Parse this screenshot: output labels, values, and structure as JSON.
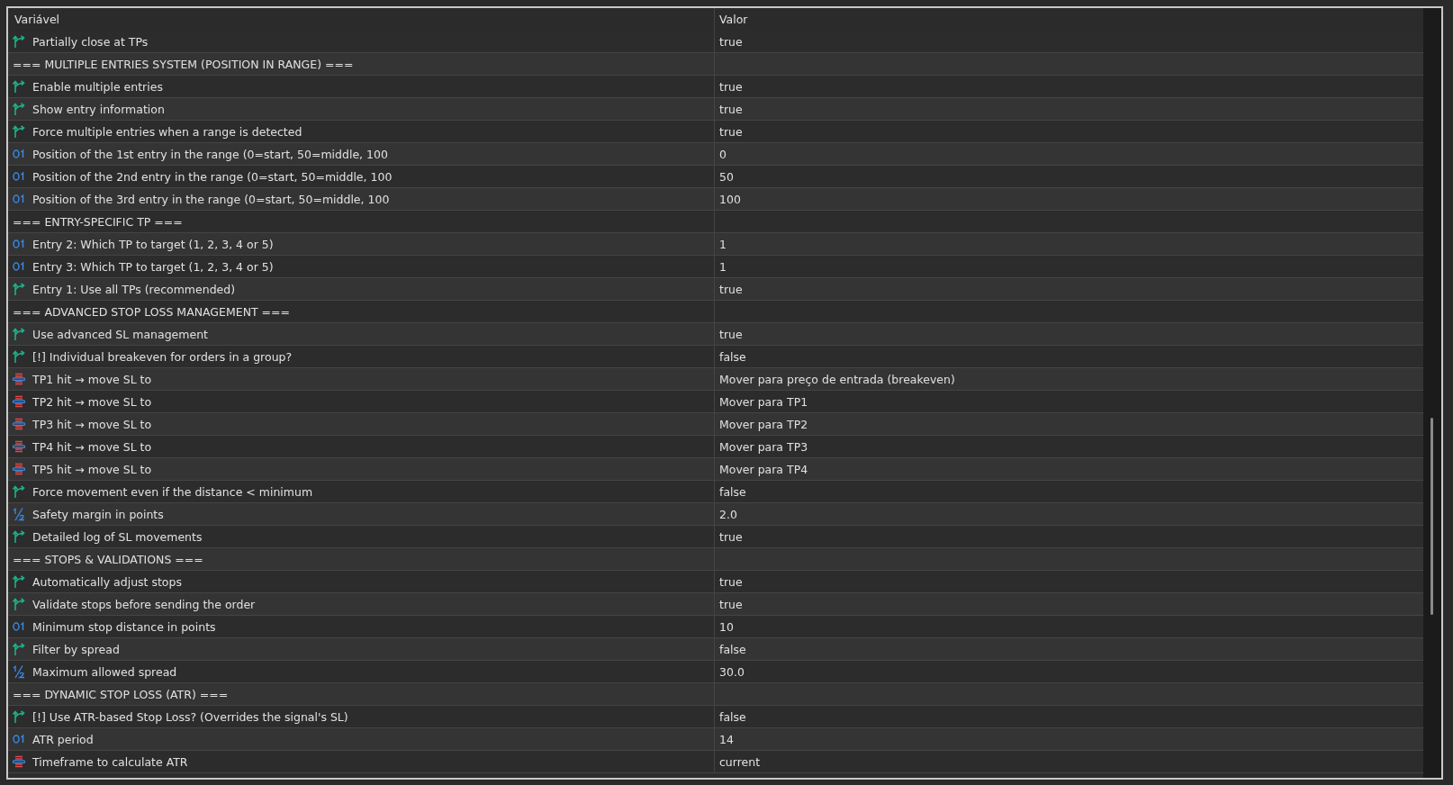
{
  "table": {
    "columns": [
      "Variável",
      "Valor"
    ],
    "rows": [
      {
        "kind": "bool",
        "name": "Partially close at TPs",
        "value": "true"
      },
      {
        "kind": "section",
        "name": "=== MULTIPLE ENTRIES SYSTEM (POSITION IN RANGE) ==="
      },
      {
        "kind": "bool",
        "name": "Enable multiple entries",
        "value": "true"
      },
      {
        "kind": "bool",
        "name": "Show entry information",
        "value": "true"
      },
      {
        "kind": "bool",
        "name": "Force multiple entries when a range is detected",
        "value": "true"
      },
      {
        "kind": "int",
        "name": "Position of the 1st entry in the range (0=start, 50=middle, 100",
        "value": "0"
      },
      {
        "kind": "int",
        "name": "Position of the 2nd entry in the range (0=start, 50=middle, 100",
        "value": "50"
      },
      {
        "kind": "int",
        "name": "Position of the 3rd entry in the range (0=start, 50=middle, 100",
        "value": "100"
      },
      {
        "kind": "section",
        "name": "=== ENTRY-SPECIFIC TP ==="
      },
      {
        "kind": "int",
        "name": "Entry 2: Which TP to target (1, 2, 3, 4 or 5)",
        "value": "1"
      },
      {
        "kind": "int",
        "name": "Entry 3: Which TP to target (1, 2, 3, 4 or 5)",
        "value": "1"
      },
      {
        "kind": "bool",
        "name": "Entry 1: Use all TPs (recommended)",
        "value": "true"
      },
      {
        "kind": "section",
        "name": "=== ADVANCED STOP LOSS MANAGEMENT ==="
      },
      {
        "kind": "bool",
        "name": "Use advanced SL management",
        "value": "true"
      },
      {
        "kind": "bool",
        "name": "[!] Individual breakeven for orders in a group?",
        "value": "false"
      },
      {
        "kind": "enum",
        "name": "TP1 hit → move SL to",
        "value": "Mover para preço de entrada (breakeven)"
      },
      {
        "kind": "enum",
        "name": "TP2 hit → move SL to",
        "value": "Mover para TP1"
      },
      {
        "kind": "enum",
        "name": "TP3 hit → move SL to",
        "value": "Mover para TP2"
      },
      {
        "kind": "enum",
        "name": "TP4 hit → move SL to",
        "value": "Mover para TP3"
      },
      {
        "kind": "enum",
        "name": "TP5 hit → move SL to",
        "value": "Mover para TP4"
      },
      {
        "kind": "bool",
        "name": "Force movement even if the distance < minimum",
        "value": "false"
      },
      {
        "kind": "double",
        "name": "Safety margin in points",
        "value": "2.0"
      },
      {
        "kind": "bool",
        "name": "Detailed log of SL movements",
        "value": "true"
      },
      {
        "kind": "section",
        "name": "=== STOPS & VALIDATIONS ==="
      },
      {
        "kind": "bool",
        "name": "Automatically adjust stops",
        "value": "true"
      },
      {
        "kind": "bool",
        "name": "Validate stops before sending the order",
        "value": "true"
      },
      {
        "kind": "int",
        "name": "Minimum stop distance in points",
        "value": "10"
      },
      {
        "kind": "bool",
        "name": "Filter by spread",
        "value": "false"
      },
      {
        "kind": "double",
        "name": "Maximum allowed spread",
        "value": "30.0"
      },
      {
        "kind": "section",
        "name": "=== DYNAMIC STOP LOSS (ATR) ==="
      },
      {
        "kind": "bool",
        "name": "[!] Use ATR-based Stop Loss? (Overrides the signal's SL)",
        "value": "false"
      },
      {
        "kind": "int",
        "name": "ATR period",
        "value": "14"
      },
      {
        "kind": "enum",
        "name": "Timeframe to calculate ATR",
        "value": "current"
      }
    ]
  }
}
